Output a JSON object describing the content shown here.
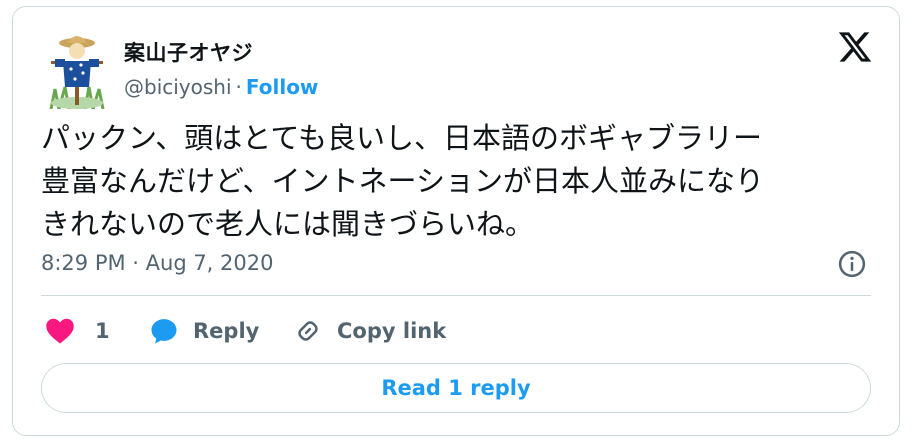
{
  "author": {
    "name": "案山子オヤジ",
    "handle": "@biciyoshi",
    "separator": "·",
    "follow_label": "Follow"
  },
  "tweet": {
    "lines": [
      "パックン、頭はとても良いし、日本語のボギャブラリー",
      "豊富なんだけど、イントネーションが日本人並みになり",
      "きれないので老人には聞きづらいね。"
    ],
    "timestamp": "8:29 PM · Aug 7, 2020"
  },
  "actions": {
    "like_count": "1",
    "reply_label": "Reply",
    "copy_label": "Copy link"
  },
  "read_replies_label": "Read 1 reply",
  "icons": {
    "brand": "x-logo-icon",
    "info": "info-icon",
    "like": "heart-icon",
    "reply": "speech-bubble-icon",
    "copy": "link-icon"
  },
  "colors": {
    "accent": "#1d9bf0",
    "like": "#f91880",
    "secondary_text": "#536471",
    "border": "#cfd9de"
  }
}
